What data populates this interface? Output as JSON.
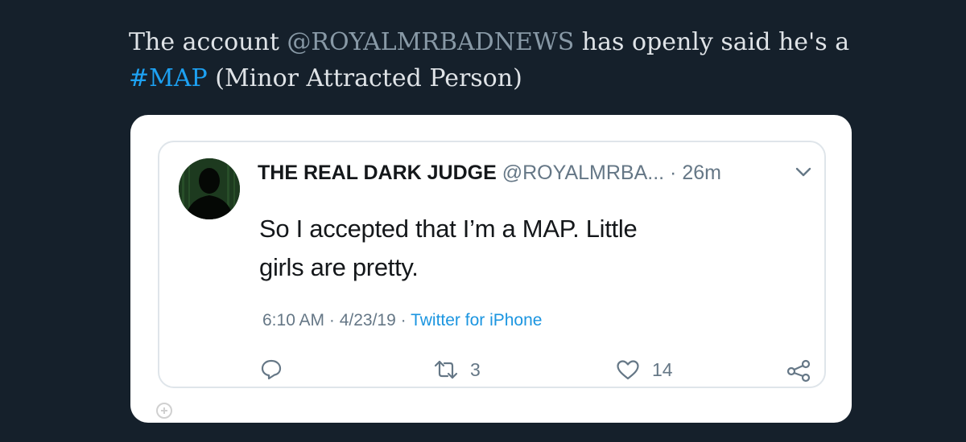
{
  "post": {
    "prefix": "The account ",
    "mention": "@ROYALMRBADNEWS",
    "middle": " has openly said he's a",
    "hashtag": "#MAP",
    "suffix": " (Minor Attracted Person)"
  },
  "tweet": {
    "display_name": "THE REAL DARK JUDGE",
    "handle": "@ROYALMRBA...",
    "time_sep": " · ",
    "time_ago": "26m",
    "body_line1": "So I accepted that I’m a MAP. Little",
    "body_line2": "girls are pretty.",
    "timestamp": "6:10 AM · 4/23/19 · ",
    "source": "Twitter for iPhone",
    "retweets": "3",
    "likes": "14"
  },
  "icons": {
    "reply": "reply-icon",
    "retweet": "retweet-icon",
    "like": "heart-icon",
    "share": "share-icon",
    "menu": "chevron-down-icon"
  },
  "colors": {
    "page_bg": "#15202b",
    "link_blue": "#1da1f2",
    "muted": "#657786"
  }
}
